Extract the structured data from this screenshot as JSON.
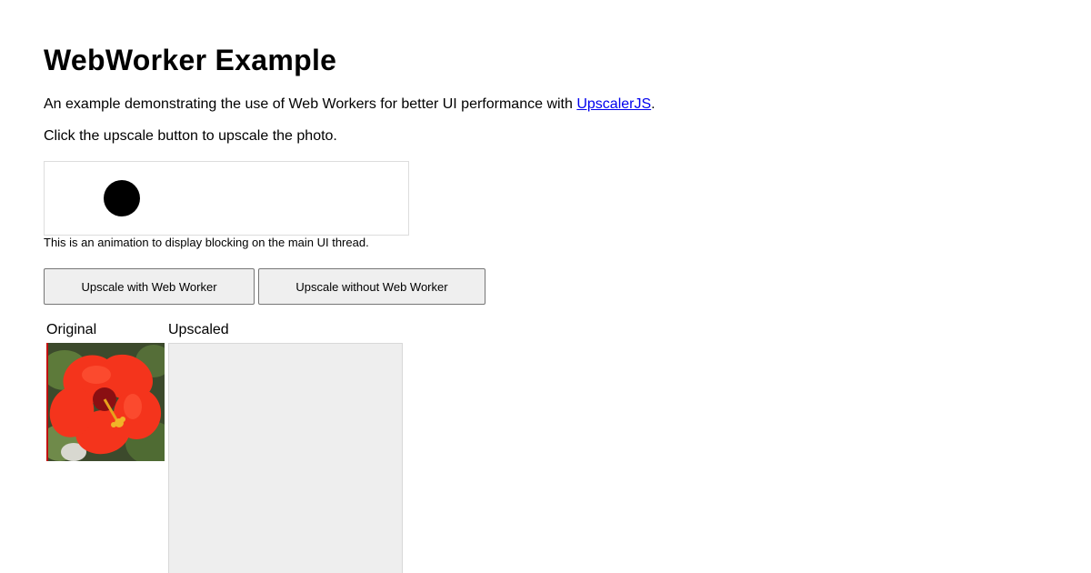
{
  "page": {
    "title": "WebWorker Example",
    "intro_text": "An example demonstrating the use of Web Workers for better UI performance with ",
    "intro_link": "UpscalerJS",
    "intro_end": ".",
    "instruction": "Click the upscale button to upscale the photo."
  },
  "animation": {
    "caption": "This is an animation to display blocking on the main UI thread."
  },
  "buttons": {
    "with_worker": "Upscale with Web Worker",
    "without_worker": "Upscale without Web Worker"
  },
  "images": {
    "original_label": "Original",
    "upscaled_label": "Upscaled"
  },
  "colors": {
    "link": "#0000ee",
    "button_bg": "#efefef",
    "placeholder_bg": "#eeeeee",
    "flower": "#f4341c"
  }
}
